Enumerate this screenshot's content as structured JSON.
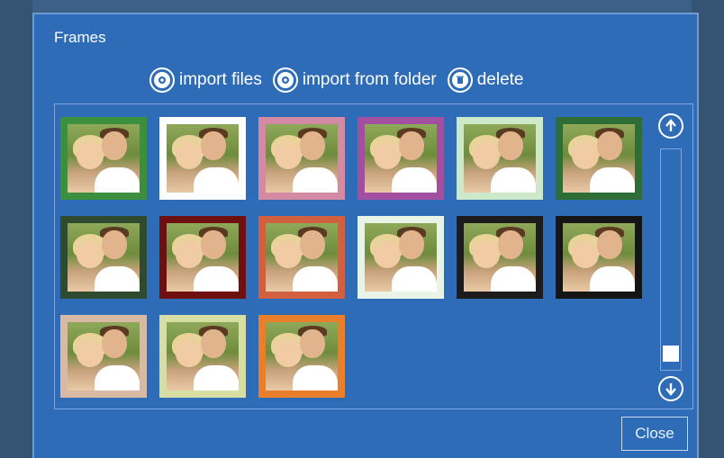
{
  "dialog": {
    "title": "Frames"
  },
  "toolbar": {
    "import_files": "import files",
    "import_folder": "import from folder",
    "delete": "delete"
  },
  "scrollbar": {
    "position": 0.96
  },
  "footer": {
    "close_label": "Close"
  },
  "frames": [
    {
      "border": "#3c8f3c"
    },
    {
      "border": "#ffffff"
    },
    {
      "border": "#d48aa3"
    },
    {
      "border": "#a34fa0"
    },
    {
      "border": "#cde9c9"
    },
    {
      "border": "#2f6d37"
    },
    {
      "border": "#2f4b2f"
    },
    {
      "border": "#6e1010"
    },
    {
      "border": "#d06040"
    },
    {
      "border": "#e8f4e6"
    },
    {
      "border": "#1c1c1c"
    },
    {
      "border": "#151515"
    },
    {
      "border": "#d7b9a4"
    },
    {
      "border": "#d7dea4"
    },
    {
      "border": "#e97e2b"
    }
  ]
}
